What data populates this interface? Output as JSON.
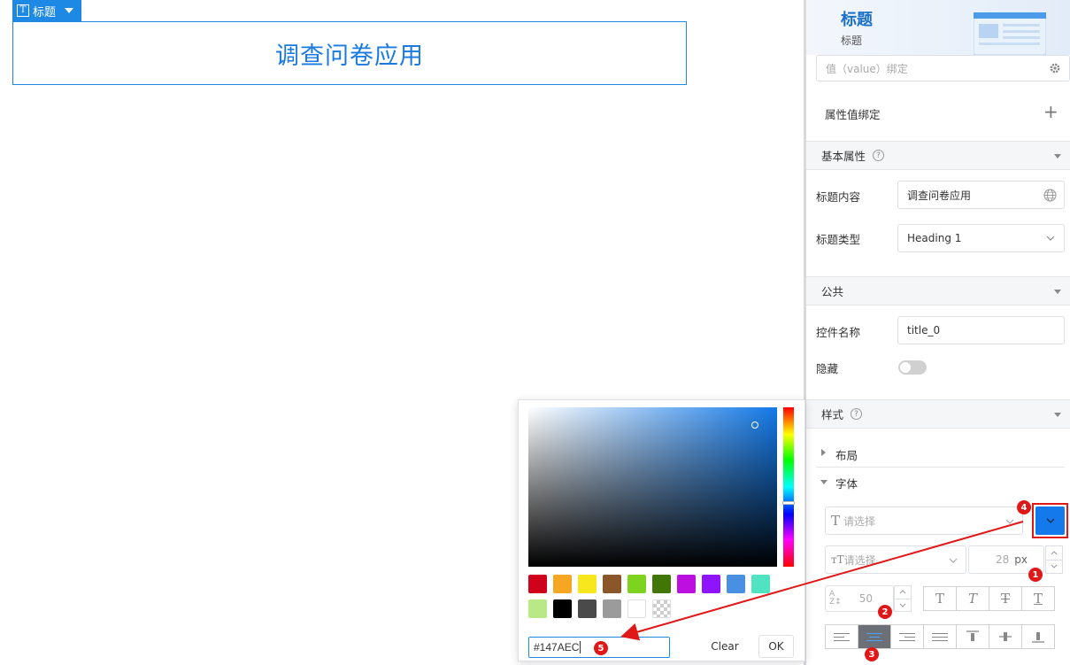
{
  "canvas": {
    "component_tag_label": "标题",
    "title_text": "调查问卷应用"
  },
  "panel": {
    "title": "标题",
    "subtitle": "标题",
    "value_binding_placeholder": "值（value）绑定",
    "attr_binding_label": "属性值绑定",
    "sections": {
      "basic": "基本属性",
      "common": "公共",
      "style": "样式"
    },
    "title_content_label": "标题内容",
    "title_content_value": "调查问卷应用",
    "title_type_label": "标题类型",
    "title_type_value": "Heading 1",
    "control_name_label": "控件名称",
    "control_name_value": "title_0",
    "hidden_label": "隐藏",
    "layout_label": "布局",
    "font_label": "字体",
    "font_family_placeholder": "请选择",
    "font_size_placeholder": "请选择",
    "font_size_value": "28",
    "font_size_unit": "px",
    "line_height_value": "50",
    "accent_color": "#1e88e5",
    "selected_color": "#147AEC"
  },
  "picker": {
    "hex_value": "#147AEC",
    "clear_label": "Clear",
    "ok_label": "OK",
    "swatches_row1": [
      "#d0021b",
      "#f5a623",
      "#f8e71c",
      "#8b572a",
      "#7ed321",
      "#417505",
      "#bd10e0",
      "#9013fe",
      "#4a90e2",
      "#50e3c2"
    ],
    "swatches_row2": [
      "#b8e986",
      "#000000",
      "#4a4a4a",
      "#9b9b9b",
      "#ffffff",
      "transparent"
    ]
  },
  "annotations": [
    "1",
    "2",
    "3",
    "4",
    "5"
  ]
}
